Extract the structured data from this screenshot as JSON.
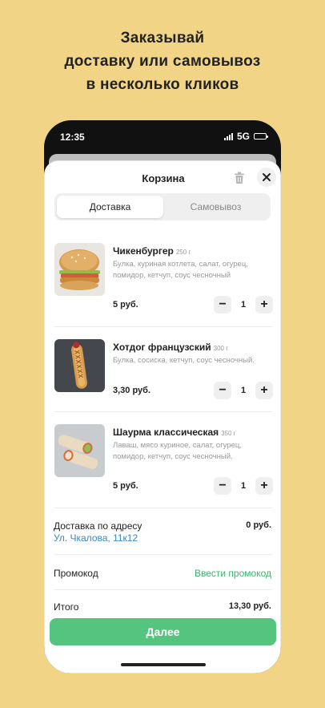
{
  "headline": {
    "line1": "Заказывай",
    "line2": "доставку или самовывоз",
    "line3": "в несколько кликов"
  },
  "status_bar": {
    "time": "12:35",
    "network": "5G"
  },
  "cart": {
    "title": "Корзина",
    "tabs": [
      {
        "label": "Доставка",
        "active": true
      },
      {
        "label": "Самовывоз",
        "active": false
      }
    ],
    "items": [
      {
        "name": "Чикенбургер",
        "weight": "250 г",
        "description": "Булка, куриная котлета, салат, огурец, помидор, кетчуп, соус чесночный",
        "price": "5 руб.",
        "qty": "1",
        "image": "burger"
      },
      {
        "name": "Хотдог французский",
        "weight": "300 г",
        "description": "Булка, сосиска, кетчуп, соус чесночный.",
        "price": "3,30 руб.",
        "qty": "1",
        "image": "hotdog"
      },
      {
        "name": "Шаурма классическая",
        "weight": "350 г",
        "description": "Лаваш, мясо куриное, салат, огурец, помидор, кетчуп, соус чесночный.",
        "price": "5 руб.",
        "qty": "1",
        "image": "shawarma"
      }
    ],
    "stepper": {
      "minus": "−",
      "plus": "+"
    },
    "delivery": {
      "label": "Доставка по адресу",
      "address": "Ул. Чкалова, 11к12",
      "price": "0 руб."
    },
    "promo": {
      "label": "Промокод",
      "action": "Ввести промокод"
    },
    "total": {
      "label": "Итого",
      "value": "13,30 руб."
    },
    "next_button": "Далее"
  },
  "colors": {
    "background": "#f1d485",
    "accent_green": "#54c47f",
    "link_blue": "#3a86c8",
    "promo_green": "#3bb36b"
  }
}
